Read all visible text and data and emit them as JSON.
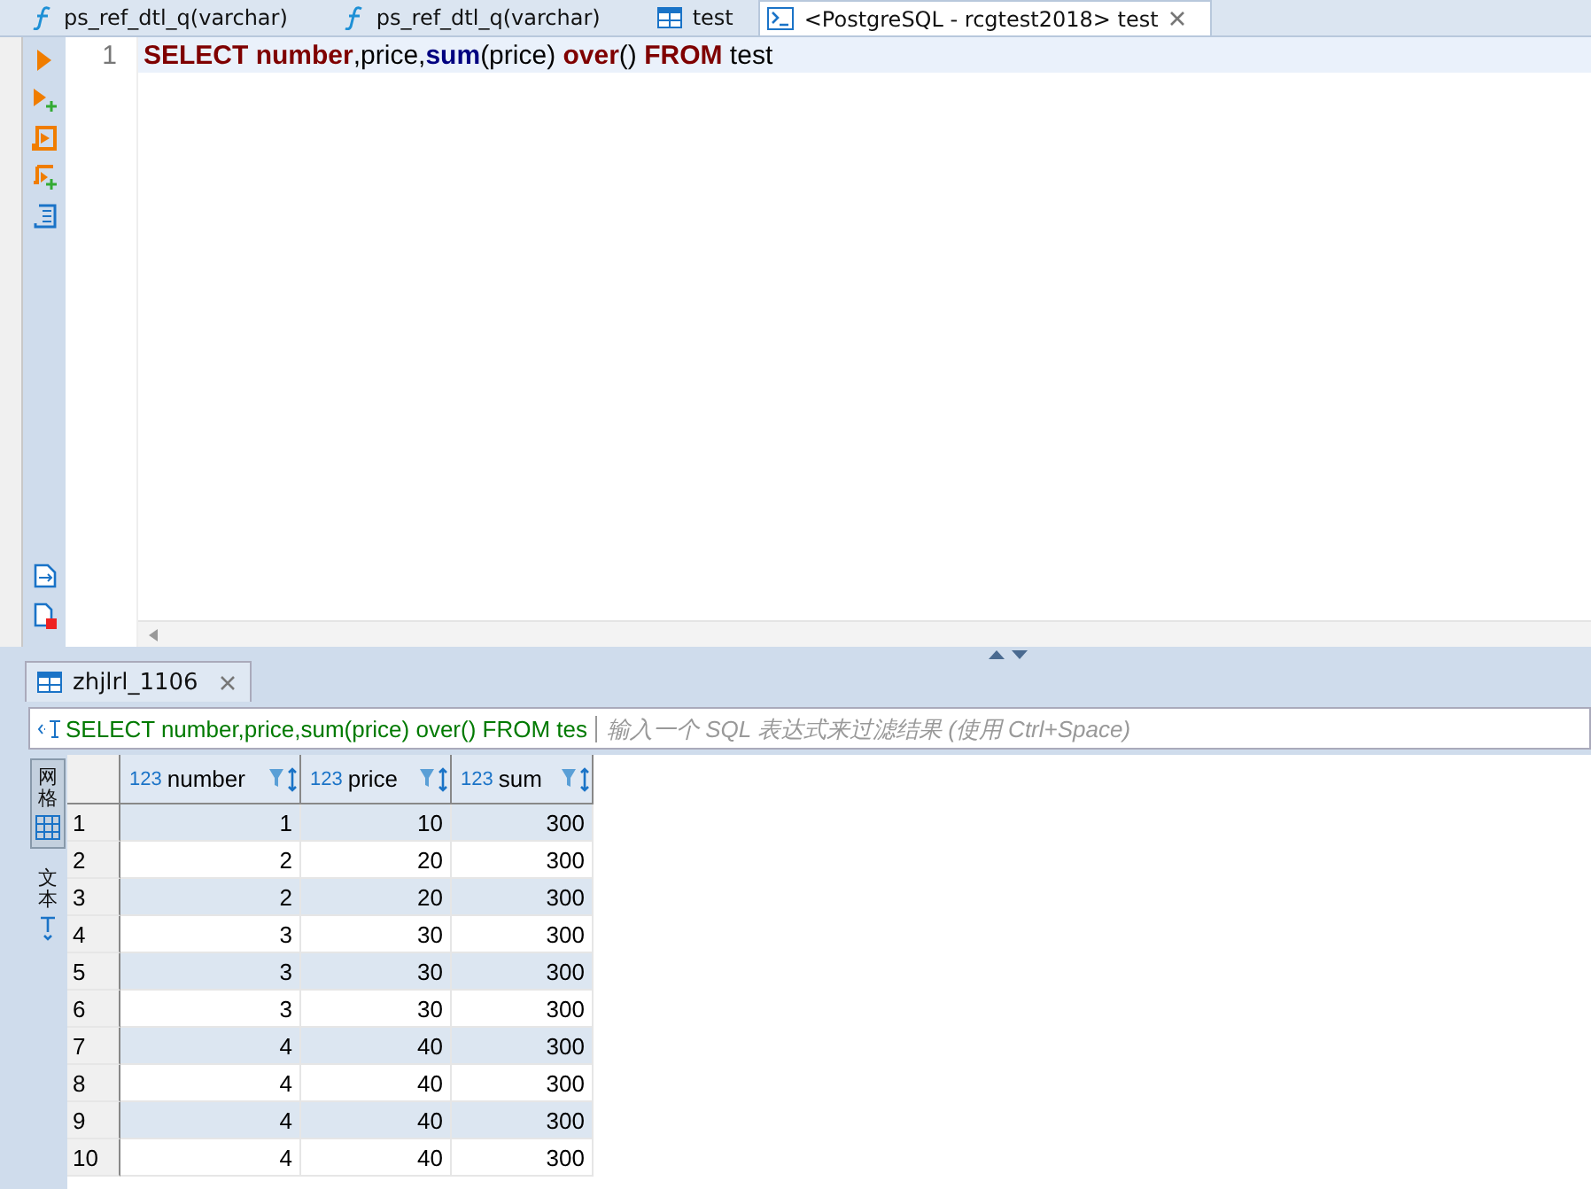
{
  "editor_tabs": [
    {
      "label": "ps_ref_dtl_q(varchar)",
      "kind": "function",
      "selected": false
    },
    {
      "label": "ps_ref_dtl_q(varchar)",
      "kind": "function",
      "selected": false
    },
    {
      "label": "test",
      "kind": "table",
      "selected": false
    },
    {
      "label": "<PostgreSQL - rcgtest2018> test",
      "kind": "console",
      "selected": true
    }
  ],
  "editor": {
    "lines": [
      {
        "number": "1",
        "tokens": [
          {
            "text": "SELECT ",
            "kind": "keyword"
          },
          {
            "text": "number",
            "kind": "keyword"
          },
          {
            "text": ",price,",
            "kind": "plain"
          },
          {
            "text": "sum",
            "kind": "function"
          },
          {
            "text": "(price) ",
            "kind": "plain"
          },
          {
            "text": "over",
            "kind": "keyword"
          },
          {
            "text": "() ",
            "kind": "plain"
          },
          {
            "text": "FROM",
            "kind": "keyword"
          },
          {
            "text": " test",
            "kind": "plain"
          }
        ]
      }
    ]
  },
  "results": {
    "tab": {
      "label": "zhjlrl_1106"
    },
    "filter": {
      "query": "SELECT number,price,sum(price) over() FROM tes",
      "placeholder": "输入一个 SQL 表达式来过滤结果 (使用 Ctrl+Space)"
    },
    "side_tabs": [
      {
        "label": "网格",
        "kind": "grid",
        "selected": true
      },
      {
        "label": "文本",
        "kind": "text",
        "selected": false
      }
    ],
    "columns": [
      {
        "type": "123",
        "name": "number"
      },
      {
        "type": "123",
        "name": "price"
      },
      {
        "type": "123",
        "name": "sum"
      }
    ],
    "rows": [
      {
        "index": "1",
        "cells": [
          "1",
          "10",
          "300"
        ]
      },
      {
        "index": "2",
        "cells": [
          "2",
          "20",
          "300"
        ]
      },
      {
        "index": "3",
        "cells": [
          "2",
          "20",
          "300"
        ]
      },
      {
        "index": "4",
        "cells": [
          "3",
          "30",
          "300"
        ]
      },
      {
        "index": "5",
        "cells": [
          "3",
          "30",
          "300"
        ]
      },
      {
        "index": "6",
        "cells": [
          "3",
          "30",
          "300"
        ]
      },
      {
        "index": "7",
        "cells": [
          "4",
          "40",
          "300"
        ]
      },
      {
        "index": "8",
        "cells": [
          "4",
          "40",
          "300"
        ]
      },
      {
        "index": "9",
        "cells": [
          "4",
          "40",
          "300"
        ]
      },
      {
        "index": "10",
        "cells": [
          "4",
          "40",
          "300"
        ]
      }
    ]
  }
}
